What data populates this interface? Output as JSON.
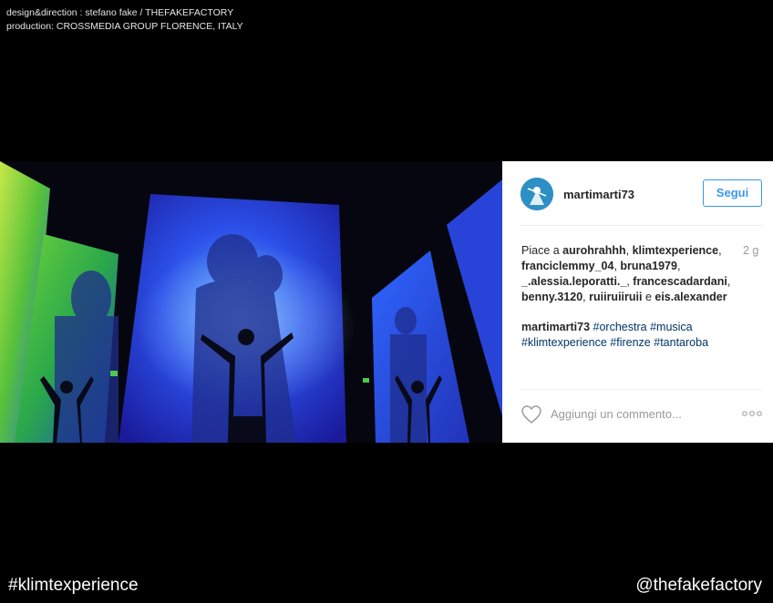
{
  "credits": {
    "line1": "design&direction : stefano fake / THEFAKEFACTORY",
    "line2": "production: CROSSMEDIA GROUP FLORENCE, ITALY"
  },
  "post": {
    "username": "martimarti73",
    "follow_label": "Segui",
    "likes_prefix": "Piace a ",
    "likers": [
      "aurohrahhh",
      "klimtexperience",
      "franciclemmy_04",
      "bruna1979",
      "_.alessia.leporatti._",
      "francescadardani",
      "benny.3120",
      "ruiiruiiruii"
    ],
    "likes_joiner": " e ",
    "last_liker": "eis.alexander",
    "time": "2 g",
    "caption_user": "martimarti73",
    "hashtags": [
      "#orchestra",
      "#musica",
      "#klimtexperience",
      "#firenze",
      "#tantaroba"
    ],
    "comment_placeholder": "Aggiungi un commento...",
    "icons": {
      "like": "heart-icon",
      "options": "more-options-icon"
    }
  },
  "footer": {
    "hashtag": "#klimtexperience",
    "handle": "@thefakefactory"
  },
  "colors": {
    "follow": "#3897f0",
    "hashtag": "#003569",
    "muted": "#999999",
    "text": "#262626"
  }
}
